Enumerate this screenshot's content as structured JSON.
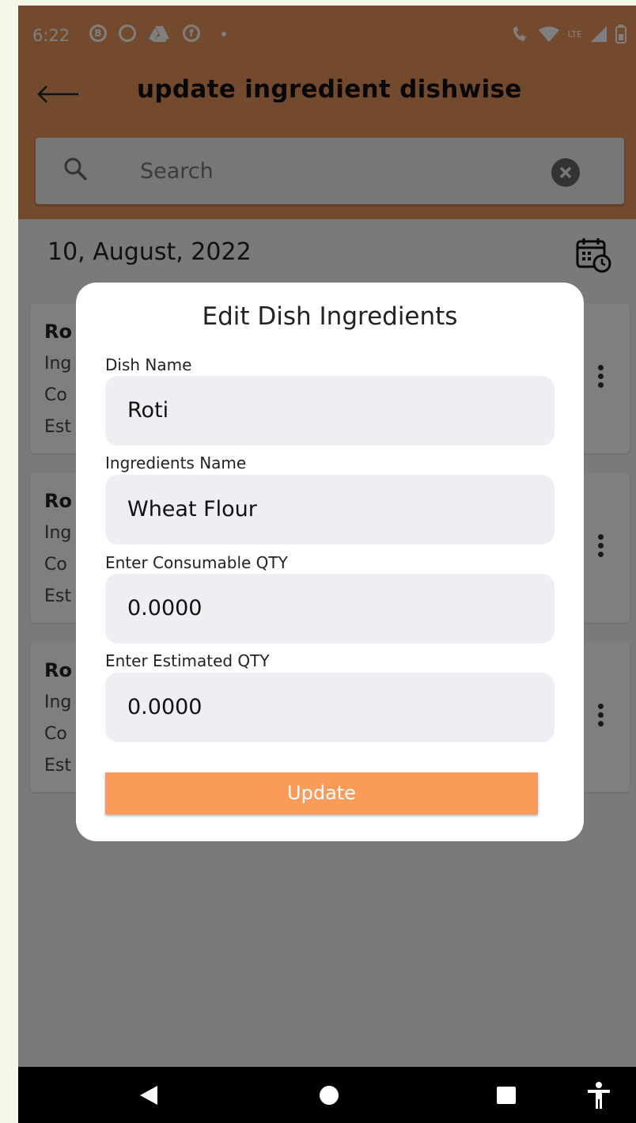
{
  "status_bar": {
    "time": "6:22",
    "left_icons": [
      "b-circle-icon",
      "chrome-icon",
      "drive-icon",
      "facebook-icon"
    ],
    "right_icons": [
      "call-wifi-icon",
      "wifi-icon",
      "lte-signal-icon",
      "battery-icon"
    ],
    "network_label": "LTE"
  },
  "app_bar": {
    "title": "update ingredient dishwise",
    "back_icon": "arrow-left-icon"
  },
  "search": {
    "placeholder": "Search"
  },
  "content": {
    "date": "10, August, 2022",
    "cards": [
      {
        "title": "Ro",
        "line1": "Ing",
        "line2": "Co",
        "line3": "Est"
      },
      {
        "title": "Ro",
        "line1": "Ing",
        "line2": "Co",
        "line3": "Est"
      },
      {
        "title": "Ro",
        "line1": "Ing",
        "line2": "Co",
        "line3": "Est"
      }
    ]
  },
  "dialog": {
    "title": "Edit Dish Ingredients",
    "fields": [
      {
        "label": "Dish Name",
        "value": "Roti"
      },
      {
        "label": "Ingredients Name",
        "value": "Wheat Flour"
      },
      {
        "label": "Enter Consumable QTY",
        "value": "0.0000"
      },
      {
        "label": "Enter Estimated QTY",
        "value": "0.0000"
      }
    ],
    "button_label": "Update"
  },
  "colors": {
    "accent": "#e7955c",
    "button": "#fb9b5a",
    "field_bg": "#efeff3"
  }
}
